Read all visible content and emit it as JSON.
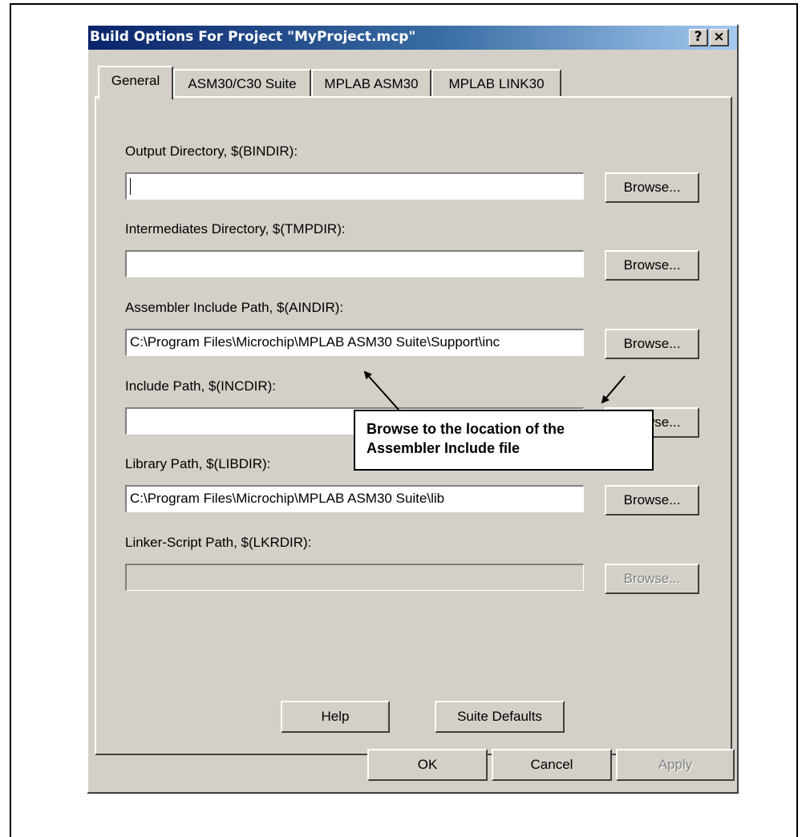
{
  "window": {
    "title": "Build Options For Project \"MyProject.mcp\"",
    "help_glyph": "?",
    "close_glyph": "×"
  },
  "tabs": [
    {
      "label": "General",
      "active": true
    },
    {
      "label": "ASM30/C30 Suite",
      "active": false
    },
    {
      "label": "MPLAB ASM30",
      "active": false
    },
    {
      "label": "MPLAB LINK30",
      "active": false
    }
  ],
  "fields": [
    {
      "label": "Output Directory, $(BINDIR):",
      "value": "",
      "button": "Browse...",
      "focused": true,
      "enabled": true
    },
    {
      "label": "Intermediates Directory, $(TMPDIR):",
      "value": "",
      "button": "Browse...",
      "enabled": true
    },
    {
      "label": "Assembler Include Path, $(AINDIR):",
      "value": "C:\\Program Files\\Microchip\\MPLAB ASM30 Suite\\Support\\inc",
      "button": "Browse...",
      "enabled": true
    },
    {
      "label": "Include Path, $(INCDIR):",
      "value": "",
      "button": "Browse...",
      "enabled": true
    },
    {
      "label": "Library Path, $(LIBDIR):",
      "value": "C:\\Program Files\\Microchip\\MPLAB ASM30 Suite\\lib",
      "button": "Browse...",
      "enabled": true
    },
    {
      "label": "Linker-Script Path, $(LKRDIR):",
      "value": "",
      "button": "Browse...",
      "enabled": false
    }
  ],
  "panel_buttons": {
    "help": "Help",
    "suite_defaults": "Suite Defaults"
  },
  "dialog_buttons": {
    "ok": "OK",
    "cancel": "Cancel",
    "apply": "Apply"
  },
  "callout": {
    "line1": "Browse to the location of the",
    "line2": "Assembler Include file"
  }
}
